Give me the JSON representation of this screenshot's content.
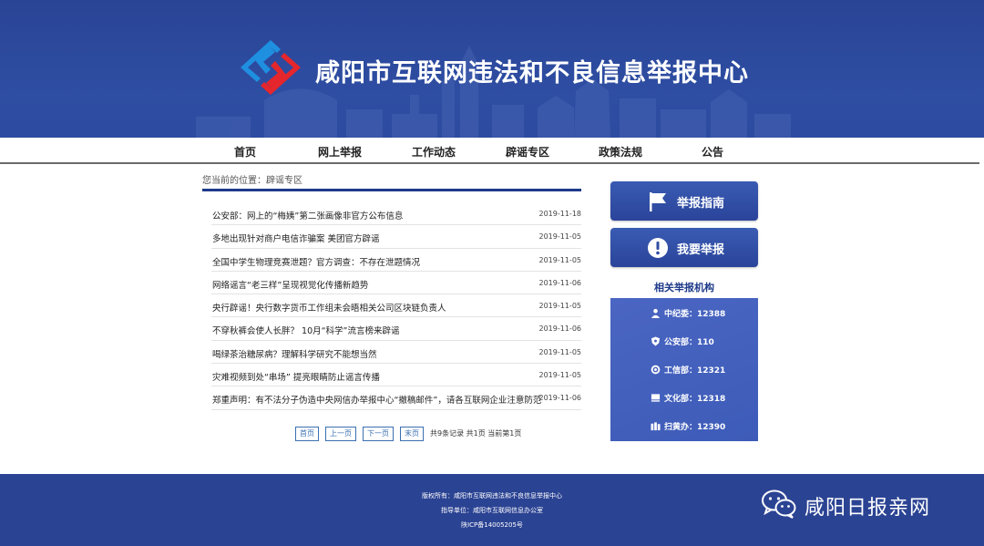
{
  "header": {
    "site_title": "咸阳市互联网违法和不良信息举报中心",
    "logo_icon": "diamond-logo-icon"
  },
  "nav": {
    "items": [
      {
        "label": "首页"
      },
      {
        "label": "网上举报"
      },
      {
        "label": "工作动态"
      },
      {
        "label": "辟谣专区"
      },
      {
        "label": "政策法规"
      },
      {
        "label": "公告"
      }
    ]
  },
  "breadcrumb": {
    "prefix": "您当前的位置：",
    "current": "辟谣专区"
  },
  "news": [
    {
      "title": "公安部：网上的“梅姨”第二张画像非官方公布信息",
      "date": "2019-11-18"
    },
    {
      "title": "多地出现针对商户电信诈骗案 美团官方辟谣",
      "date": "2019-11-05"
    },
    {
      "title": "全国中学生物理竞赛泄题？官方调查：不存在泄题情况",
      "date": "2019-11-05"
    },
    {
      "title": "网络谣言“老三样”呈现视觉化传播新趋势",
      "date": "2019-11-06"
    },
    {
      "title": "央行辟谣！央行数字货币工作组未会晤相关公司区块链负责人",
      "date": "2019-11-05"
    },
    {
      "title": "不穿秋裤会使人长胖？ 10月“科学”流言榜来辟谣",
      "date": "2019-11-06"
    },
    {
      "title": "喝绿茶治糖尿病？理解科学研究不能想当然",
      "date": "2019-11-05"
    },
    {
      "title": "灾难视频到处“串场” 提亮眼睛防止谣言传播",
      "date": "2019-11-05"
    },
    {
      "title": "郑重声明：有不法分子伪造中央网信办举报中心“撤稿邮件”，请各互联网企业注意防范",
      "date": "2019-11-06"
    }
  ],
  "pager": {
    "first": "首页",
    "prev": "上一页",
    "next": "下一页",
    "last": "末页",
    "info": "共9条记录 共1页 当前第1页"
  },
  "sidebar": {
    "guide_label": "举报指南",
    "guide_icon": "flag-icon",
    "report_label": "我要举报",
    "report_icon": "exclamation-icon",
    "related_title": "相关举报机构",
    "orgs": [
      {
        "label": "中纪委：12388",
        "icon": "person-icon"
      },
      {
        "label": "公安部：110",
        "icon": "police-badge-icon"
      },
      {
        "label": "工信部：12321",
        "icon": "emblem-icon"
      },
      {
        "label": "文化部：12318",
        "icon": "book-icon"
      },
      {
        "label": "扫黄办：12390",
        "icon": "books-icon"
      }
    ]
  },
  "footer": {
    "copyright": "版权所有：咸阳市互联网违法和不良信息举报中心",
    "sponsor": "指导单位：咸阳市互联网信息办公室",
    "icp": "陕ICP备14005205号"
  },
  "watermark": {
    "text": "咸阳日报亲网",
    "icon": "wechat-icon"
  },
  "colors": {
    "header_blue": "#2e4ea3",
    "footer_blue": "#2b4393",
    "accent_navy": "#1e3a8a",
    "logo_red": "#e5262c",
    "logo_blue": "#1f8fe0"
  }
}
